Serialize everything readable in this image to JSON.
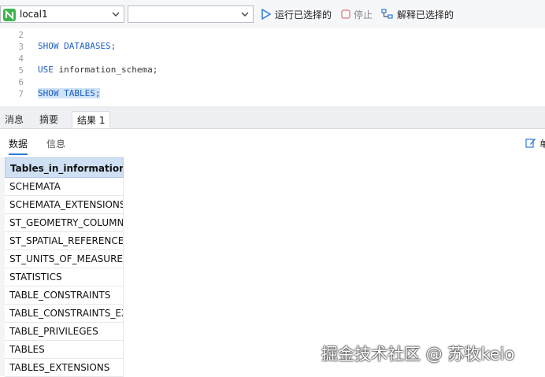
{
  "toolbar": {
    "connection": "local1",
    "database": "",
    "run_selected": "运行已选择的",
    "stop": "停止",
    "explain_selected": "解释已选择的"
  },
  "editor": {
    "lines": [
      {
        "num": "2",
        "code": ""
      },
      {
        "num": "3",
        "code": "SHOW DATABASES;"
      },
      {
        "num": "4",
        "code": ""
      },
      {
        "num": "5",
        "code": "USE information_schema;"
      },
      {
        "num": "6",
        "code": ""
      },
      {
        "num": "7",
        "code": "SHOW TABLES;"
      }
    ]
  },
  "tabs": [
    "消息",
    "摘要",
    "结果 1"
  ],
  "subtabs": [
    "数据",
    "信息"
  ],
  "edit_label": "单",
  "grid": {
    "header": "Tables_in_information_schema",
    "rows": [
      "SCHEMATA",
      "SCHEMATA_EXTENSIONS",
      "ST_GEOMETRY_COLUMNS",
      "ST_SPATIAL_REFERENCE_SYSTEMS",
      "ST_UNITS_OF_MEASURE",
      "STATISTICS",
      "TABLE_CONSTRAINTS",
      "TABLE_CONSTRAINTS_EXTENSIONS",
      "TABLE_PRIVILEGES",
      "TABLES",
      "TABLES_EXTENSIONS"
    ]
  },
  "watermark": "掘金技术社区 @ 苏牧keio",
  "colors": {
    "accent": "#2f7ad8",
    "connection_icon": "#3bb54a",
    "header_bg": "#cfe0f4",
    "selection_bg": "#cfe3f7"
  },
  "icons": {
    "connection": "connection-icon",
    "run": "play-icon",
    "stop": "stop-icon",
    "explain": "explain-icon",
    "edit": "edit-icon"
  }
}
